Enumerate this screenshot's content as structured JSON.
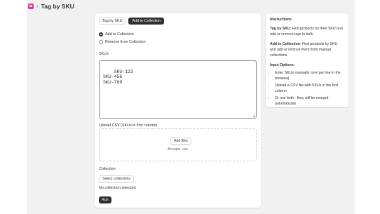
{
  "header": {
    "title": "Tag by SKU",
    "separator": "›"
  },
  "tabs": [
    {
      "label": "Tag by SKU",
      "active": false
    },
    {
      "label": "Add to Collection",
      "active": true
    }
  ],
  "mode_options": [
    {
      "label": "Add to Collection",
      "checked": true
    },
    {
      "label": "Remove from Collection",
      "checked": false
    }
  ],
  "skus": {
    "label": "SKUs",
    "value": "SKU-123\nSKU-456\nSKU-789"
  },
  "upload": {
    "label": "Upload CSV (SKUs in first column)",
    "button_label": "Add files",
    "accepts_text": "Accepts .csv"
  },
  "collection": {
    "label": "Collection",
    "button_label": "Select collections",
    "status_text": "No collection selected"
  },
  "run_label": "Run",
  "instructions": {
    "title": "Instructions",
    "tag_heading": "Tag by SKU",
    "tag_text": ": Find products by their SKU and add or remove tags in bulk.",
    "collection_heading": "Add to Collection",
    "collection_text": ": Find products by SKU and add or remove them from manual collections.",
    "input_heading": "Input Options:",
    "input_items": [
      "Enter SKUs manually (one per line in the textarea)",
      "Upload a CSV file with SKUs in the first column",
      "Or use both - they will be merged automatically"
    ]
  },
  "colors": {
    "primary_dark": "#303030",
    "canvas_bg": "#f1f1f1",
    "logo_gradient_start": "#e0457b",
    "logo_gradient_end": "#b83b9e"
  }
}
